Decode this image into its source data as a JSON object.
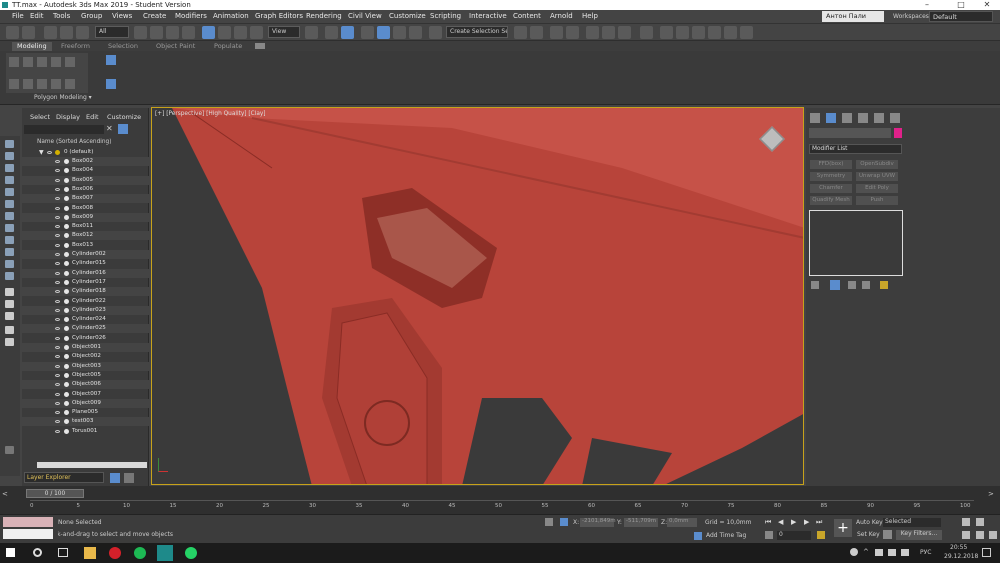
{
  "window": {
    "title": "TT.max - Autodesk 3ds Max 2019 - Student Version"
  },
  "menu": {
    "items": [
      "File",
      "Edit",
      "Tools",
      "Group",
      "Views",
      "Create",
      "Modifiers",
      "Animation",
      "Graph Editors",
      "Rendering",
      "Civil View",
      "Customize",
      "Scripting",
      "Interactive",
      "Content",
      "Arnold",
      "Help"
    ]
  },
  "user": {
    "name": "Антон Пали",
    "workspaces_label": "Workspaces:",
    "workspace": "Default"
  },
  "toolbar": {
    "filter": "All",
    "view": "View",
    "create_selection_set": "Create Selection Se"
  },
  "ribbon": {
    "tabs": [
      "Modeling",
      "Freeform",
      "Selection",
      "Object Paint",
      "Populate"
    ],
    "panel_label": "Polygon Modeling ▾"
  },
  "scene_explorer": {
    "tabs": [
      "Select",
      "Display",
      "Edit",
      "Customize"
    ],
    "header": "Name (Sorted Ascending)",
    "root": "0 (default)",
    "items": [
      "Box002",
      "Box004",
      "Box005",
      "Box006",
      "Box007",
      "Box008",
      "Box009",
      "Box011",
      "Box012",
      "Box013",
      "Cylinder002",
      "Cylinder015",
      "Cylinder016",
      "Cylinder017",
      "Cylinder018",
      "Cylinder022",
      "Cylinder023",
      "Cylinder024",
      "Cylinder025",
      "Cylinder026",
      "Object001",
      "Object002",
      "Object003",
      "Object005",
      "Object006",
      "Object007",
      "Object009",
      "Plane005",
      "test003",
      "Torus001"
    ],
    "footer": "Layer Explorer"
  },
  "viewport": {
    "label": "[+] [Perspective] [High Quality] [Clay]"
  },
  "command_panel": {
    "modifier_list": "Modifier List",
    "buttons": [
      "FFD(box)",
      "OpenSubdiv",
      "Symmetry",
      "Unwrap UVW",
      "Chamfer",
      "Edit Poly",
      "Quadify Mesh",
      "Push"
    ],
    "swatch_color": "#e0218a"
  },
  "timeline": {
    "frame": "0 / 100",
    "ticks": [
      "0",
      "5",
      "10",
      "15",
      "20",
      "25",
      "30",
      "35",
      "40",
      "45",
      "50",
      "55",
      "60",
      "65",
      "70",
      "75",
      "80",
      "85",
      "90",
      "95",
      "100"
    ]
  },
  "status": {
    "selection": "None Selected",
    "prompt": "Click or click-and-drag to select and move objects",
    "x_label": "X:",
    "x": "-2101,849m",
    "y_label": "Y:",
    "y": "-511,709m",
    "z_label": "Z:",
    "z": "0,0mm",
    "grid": "Grid = 10,0mm",
    "add_time_tag": "Add Time Tag",
    "auto_key": "Auto Key",
    "set_key": "Set Key",
    "selected": "Selected",
    "key_filters": "Key Filters...",
    "frame_value": "0"
  },
  "taskbar": {
    "lang": "РУС",
    "time": "20:55",
    "date": "29.12.2018"
  },
  "colors": {
    "accent": "#5a8ccd",
    "model": "#b8443a",
    "viewport_border": "#c7a21a"
  }
}
